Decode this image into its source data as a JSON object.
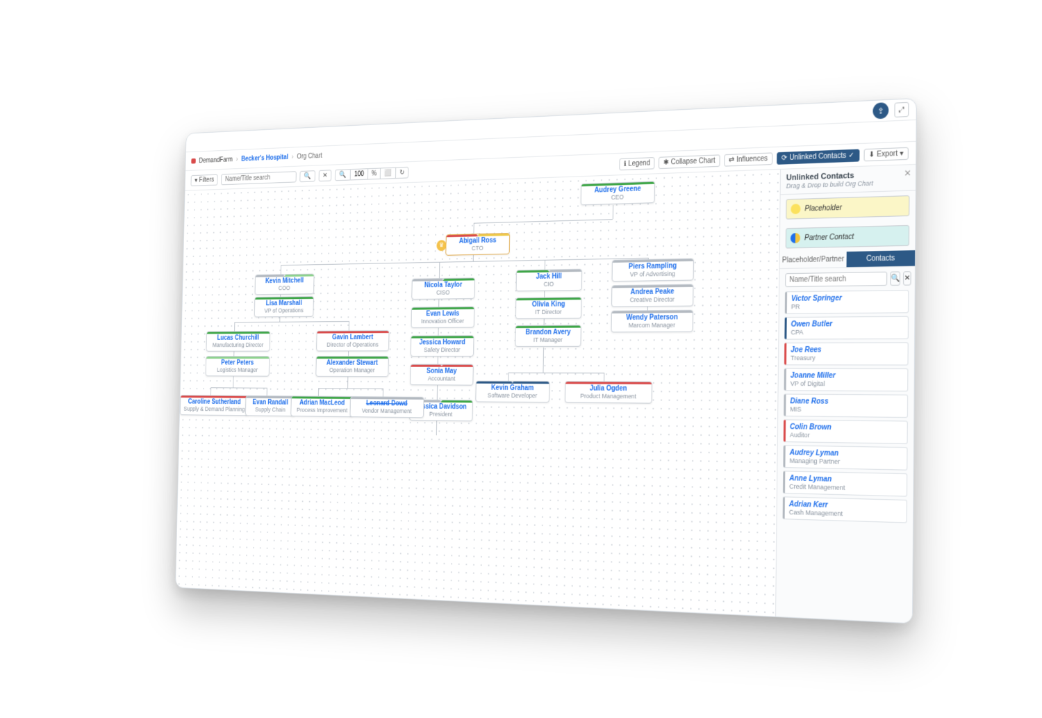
{
  "app_name": "DemandFarm",
  "breadcrumb": {
    "account": "Becker's Hospital",
    "page": "Org Chart"
  },
  "toolbar": {
    "filters": "Filters",
    "search_placeholder": "Name/Title search",
    "zoom": "100",
    "legend": "Legend",
    "collapse": "Collapse Chart",
    "influences": "Influences",
    "unlinked": "Unlinked Contacts",
    "export": "Export"
  },
  "sidebar": {
    "title": "Unlinked Contacts",
    "subtitle": "Drag & Drop to build Org Chart",
    "placeholder": "Placeholder",
    "partner": "Partner Contact",
    "tab1": "Placeholder/Partner",
    "tab2": "Contacts",
    "search_placeholder": "Name/Title search",
    "contacts": [
      {
        "name": "Victor Springer",
        "role": "PR",
        "c": "bl-grey"
      },
      {
        "name": "Owen Butler",
        "role": "CPA",
        "c": "bl-blue"
      },
      {
        "name": "Joe Rees",
        "role": "Treasury",
        "c": "bl-red"
      },
      {
        "name": "Joanne Miller",
        "role": "VP of Digital",
        "c": "bl-grey"
      },
      {
        "name": "Diane Ross",
        "role": "MIS",
        "c": "bl-grey"
      },
      {
        "name": "Colin Brown",
        "role": "Auditor",
        "c": "bl-red"
      },
      {
        "name": "Audrey Lyman",
        "role": "Managing Partner",
        "c": "bl-grey"
      },
      {
        "name": "Anne Lyman",
        "role": "Credit Management",
        "c": "bl-grey"
      },
      {
        "name": "Adrian Kerr",
        "role": "Cash Management",
        "c": "bl-grey"
      }
    ]
  },
  "nodes": {
    "audrey": {
      "name": "Audrey Greene",
      "role": "CEO"
    },
    "abigail": {
      "name": "Abigail Ross",
      "role": "CTO"
    },
    "kevin_m": {
      "name": "Kevin Mitchell",
      "role": "COO"
    },
    "lisa": {
      "name": "Lisa Marshall",
      "role": "VP of Operations"
    },
    "nicola": {
      "name": "Nicola Taylor",
      "role": "CISO"
    },
    "jack": {
      "name": "Jack Hill",
      "role": "CIO"
    },
    "piers": {
      "name": "Piers Rampling",
      "role": "VP of Advertising"
    },
    "andrea": {
      "name": "Andrea Peake",
      "role": "Creative Director"
    },
    "wendy": {
      "name": "Wendy Paterson",
      "role": "Marcom Manager"
    },
    "olivia": {
      "name": "Olivia King",
      "role": "IT Director"
    },
    "brandon": {
      "name": "Brandon Avery",
      "role": "IT Manager"
    },
    "kevin_g": {
      "name": "Kevin Graham",
      "role": "Software Developer"
    },
    "julia": {
      "name": "Julia Ogden",
      "role": "Product Management"
    },
    "evan_l": {
      "name": "Evan Lewis",
      "role": "Innovation Officer"
    },
    "jessica_h": {
      "name": "Jessica Howard",
      "role": "Safety Director"
    },
    "sonia": {
      "name": "Sonia May",
      "role": "Accountant"
    },
    "jessica_d": {
      "name": "Jessica Davidson",
      "role": "President"
    },
    "lucas": {
      "name": "Lucas Churchill",
      "role": "Manufacturing Director"
    },
    "peter": {
      "name": "Peter Peters",
      "role": "Logistics Manager"
    },
    "caroline": {
      "name": "Caroline Sutherland",
      "role": "Supply & Demand Planning"
    },
    "evan_r": {
      "name": "Evan Randall",
      "role": "Supply Chain"
    },
    "gavin": {
      "name": "Gavin Lambert",
      "role": "Director of Operations"
    },
    "alex": {
      "name": "Alexander Stewart",
      "role": "Operation Manager"
    },
    "adrian": {
      "name": "Adrian MacLeod",
      "role": "Process Improvement"
    },
    "leonard": {
      "name": "Leonard Dowd",
      "role": "Vendor Management"
    }
  }
}
